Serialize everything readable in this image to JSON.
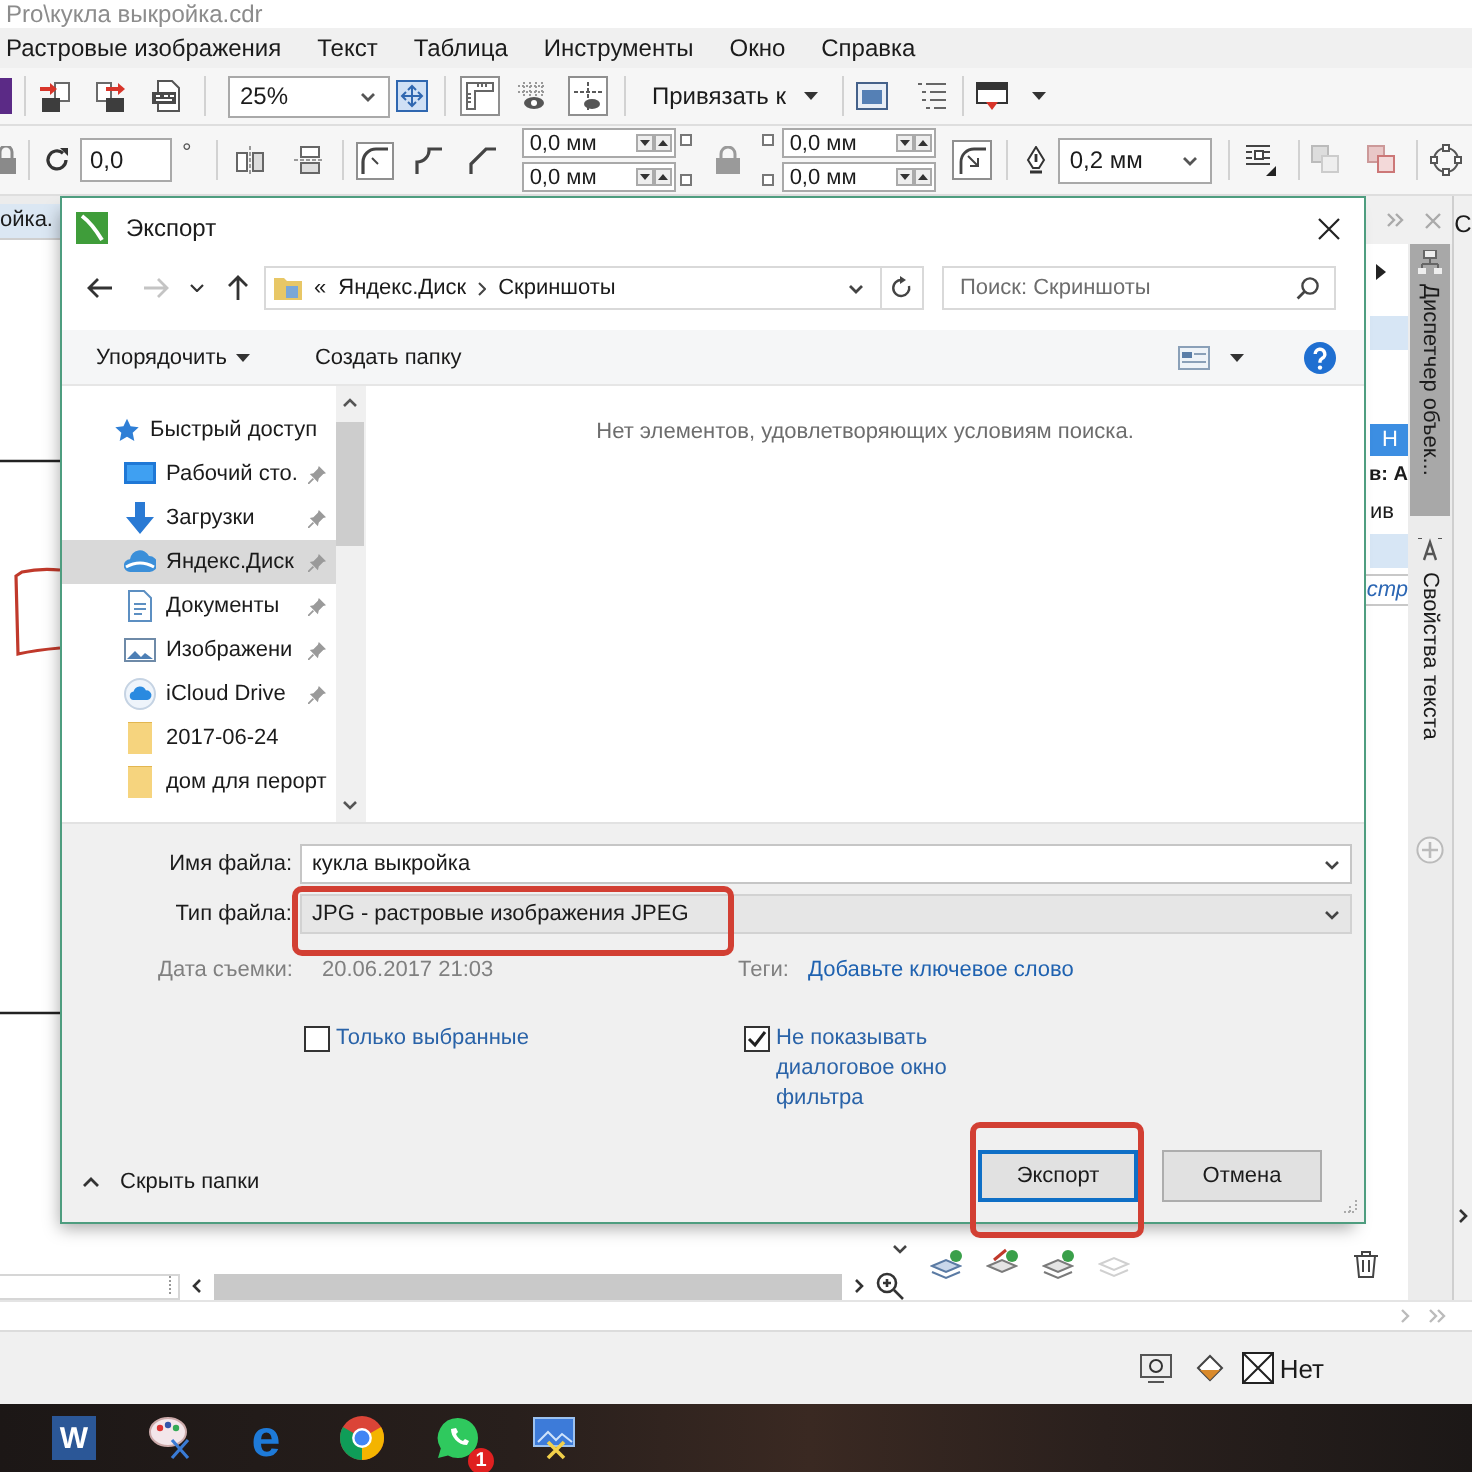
{
  "window": {
    "title": "Pro\\кукла выкройка.cdr"
  },
  "menu": [
    {
      "label": "Растровые изображения"
    },
    {
      "label": "Текст"
    },
    {
      "label": "Таблица"
    },
    {
      "label": "Инструменты"
    },
    {
      "label": "Окно"
    },
    {
      "label": "Справка"
    }
  ],
  "toolbar": {
    "zoom": "25%",
    "view_toggles": [
      {
        "kind": "rulers",
        "on": true
      },
      {
        "kind": "grid",
        "on": false
      },
      {
        "kind": "guides",
        "on": true
      }
    ],
    "snap": "Привязать к"
  },
  "property_bar": {
    "rotation": "0,0",
    "rotation_unit": "°",
    "corner_styles": [
      {
        "kind": "round",
        "selected": true
      },
      {
        "kind": "scallop",
        "selected": false
      },
      {
        "kind": "chamfer",
        "selected": false
      }
    ],
    "corner_sizes": [
      [
        "0,0 мм",
        "0,0 мм"
      ],
      [
        "0,0 мм",
        "0,0 мм"
      ]
    ],
    "scale_corners": {
      "on": true
    },
    "outline_width": "0,2 мм"
  },
  "document_tab": {
    "label": "ойка."
  },
  "dialog": {
    "title": "Экспорт",
    "nav_buttons": [
      {
        "kind": "back",
        "disabled": false
      },
      {
        "kind": "forward",
        "disabled": true
      },
      {
        "kind": "recent",
        "disabled": false
      },
      {
        "kind": "up",
        "disabled": false
      }
    ],
    "address": {
      "overflow": "«",
      "path": [
        "Яндекс.Диск",
        "Скриншоты"
      ]
    },
    "search": {
      "placeholder": "Поиск: Скриншоты"
    },
    "commands": [
      {
        "label": "Упорядочить",
        "has_menu": true
      },
      {
        "label": "Создать папку",
        "has_menu": false
      }
    ],
    "nav_items": [
      {
        "label": "Быстрый доступ",
        "kind": "star",
        "pinned": false,
        "selected": false
      },
      {
        "label": "Рабочий сто.",
        "kind": "desktop",
        "pinned": true,
        "selected": false
      },
      {
        "label": "Загрузки",
        "kind": "download",
        "pinned": true,
        "selected": false
      },
      {
        "label": "Яндекс.Диск",
        "kind": "cloud",
        "pinned": true,
        "selected": true
      },
      {
        "label": "Документы",
        "kind": "document",
        "pinned": true,
        "selected": false
      },
      {
        "label": "Изображени",
        "kind": "picture",
        "pinned": true,
        "selected": false
      },
      {
        "label": "iCloud Drive",
        "kind": "icloud",
        "pinned": true,
        "selected": false
      },
      {
        "label": "2017-06-24",
        "kind": "folder",
        "pinned": false,
        "selected": false
      },
      {
        "label": "дом для перорт",
        "kind": "folder",
        "pinned": false,
        "selected": false
      }
    ],
    "empty_message": "Нет элементов, удовлетворяющих условиям поиска.",
    "file_name": {
      "label": "Имя файла:",
      "value": "кукла выкройка"
    },
    "file_type": {
      "label": "Тип файла:",
      "value": "JPG - растровые изображения JPEG",
      "highlighted": true
    },
    "metadata": [
      {
        "label": "Дата съемки:",
        "value": "20.06.2017 21:03",
        "kind": "text"
      },
      {
        "label": "Теги:",
        "value": "Добавьте ключевое слово",
        "kind": "link"
      }
    ],
    "options": [
      {
        "label": "Только выбранные",
        "checked": false
      },
      {
        "label": "Не показывать диалоговое окно фильтра",
        "checked": true
      }
    ],
    "hide_folders": "Скрыть папки",
    "buttons": [
      {
        "label": "Экспорт",
        "default": true,
        "highlighted": true
      },
      {
        "label": "Отмена",
        "default": false,
        "highlighted": false
      }
    ]
  },
  "side_panel": {
    "header_letter": "С",
    "object_rows": [
      {
        "text": "Н",
        "kind": "selected"
      },
      {
        "text": "в: А",
        "kind": "bold"
      },
      {
        "text": "ив",
        "kind": "plain"
      },
      {
        "text": "стр",
        "kind": "italic"
      }
    ],
    "tabs": [
      {
        "label": "Диспетчер объек...",
        "selected": true
      },
      {
        "label": "Свойства текста",
        "selected": false
      }
    ]
  },
  "status_bar": {
    "fill": "Нет"
  },
  "taskbar": {
    "apps": [
      {
        "kind": "word",
        "glyph": "W"
      },
      {
        "kind": "paint"
      },
      {
        "kind": "edge",
        "glyph": "e"
      },
      {
        "kind": "chrome"
      },
      {
        "kind": "whatsapp",
        "badge": "1"
      },
      {
        "kind": "snip"
      }
    ]
  }
}
